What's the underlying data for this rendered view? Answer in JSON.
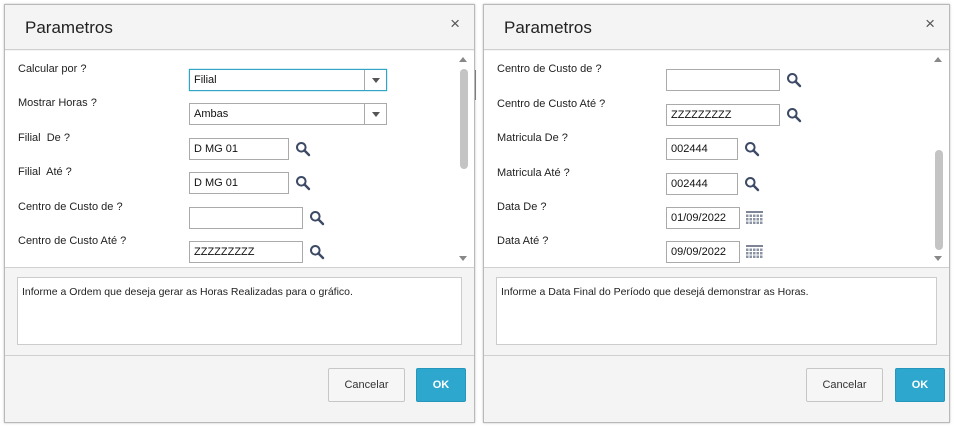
{
  "dialogs": [
    {
      "title": "Parametros",
      "close_glyph": "×",
      "params": [
        {
          "label": "Calcular por ?",
          "kind": "dropdown",
          "value": "Filial",
          "focused": true
        },
        {
          "label": "Mostrar Horas ?",
          "kind": "dropdown",
          "value": "Ambas"
        },
        {
          "label": "Filial  De ?",
          "kind": "lookup",
          "value": "D MG 01"
        },
        {
          "label": "Filial  Até ?",
          "kind": "lookup",
          "value": "D MG 01"
        },
        {
          "label": "Centro de Custo de ?",
          "kind": "lookup",
          "value": ""
        },
        {
          "label": "Centro de Custo Até ?",
          "kind": "lookup",
          "value": "ZZZZZZZZZ"
        }
      ],
      "help_text": "Informe a Ordem que deseja gerar as Horas Realizadas para o gráfico.",
      "cancel_label": "Cancelar",
      "ok_label": "OK",
      "scroll_thumb": {
        "start": 0.0,
        "end": 0.55
      }
    },
    {
      "title": "Parametros",
      "close_glyph": "×",
      "params": [
        {
          "label": "",
          "kind": "partial",
          "value": ""
        },
        {
          "label": "Centro de Custo de ?",
          "kind": "lookup",
          "value": ""
        },
        {
          "label": "Centro de Custo Até ?",
          "kind": "lookup",
          "value": "ZZZZZZZZZ"
        },
        {
          "label": "Matricula De ?",
          "kind": "lookup",
          "value": "002444"
        },
        {
          "label": "Matricula Até ?",
          "kind": "lookup",
          "value": "002444"
        },
        {
          "label": "Data De ?",
          "kind": "date",
          "value": "01/09/2022"
        },
        {
          "label": "Data Até ?",
          "kind": "date",
          "value": "09/09/2022"
        }
      ],
      "help_text": "Informe a Data Final do Período que desejá demonstrar as Horas.",
      "cancel_label": "Cancelar",
      "ok_label": "OK",
      "scroll_thumb": {
        "start": 0.45,
        "end": 1.0
      }
    }
  ],
  "icons": {
    "lookup": "magnifier-icon",
    "date": "calendar-icon",
    "dropdown": "chevron-down-icon"
  },
  "colors": {
    "accent": "#2ea7cf",
    "focus_border": "#32a4c6",
    "dialog_bg": "#f4f4f4"
  }
}
